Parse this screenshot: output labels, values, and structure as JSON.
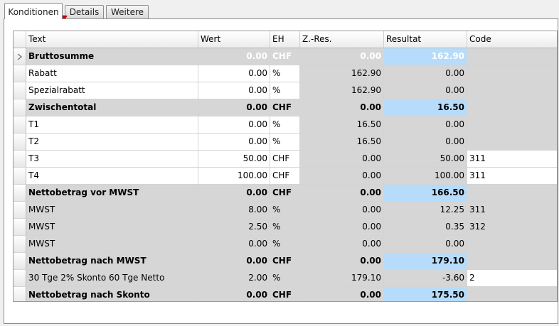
{
  "tabs": [
    {
      "label": "Konditionen",
      "active": true
    },
    {
      "label": "Details",
      "active": false
    },
    {
      "label": "Weitere",
      "active": false
    }
  ],
  "columns": {
    "text": "Text",
    "wert": "Wert",
    "eh": "EH",
    "zres": "Z.-Res.",
    "resultat": "Resultat",
    "code": "Code"
  },
  "rows": [
    {
      "text": "Bruttosumme",
      "wert": "0.00",
      "eh": "CHF",
      "zres": "0.00",
      "resultat": "162.90",
      "code": ""
    },
    {
      "text": "Rabatt",
      "wert": "0.00",
      "eh": "%",
      "zres": "162.90",
      "resultat": "0.00",
      "code": ""
    },
    {
      "text": "Spezialrabatt",
      "wert": "0.00",
      "eh": "%",
      "zres": "162.90",
      "resultat": "0.00",
      "code": ""
    },
    {
      "text": "Zwischentotal",
      "wert": "0.00",
      "eh": "CHF",
      "zres": "0.00",
      "resultat": "16.50",
      "code": ""
    },
    {
      "text": "T1",
      "wert": "0.00",
      "eh": "%",
      "zres": "16.50",
      "resultat": "0.00",
      "code": ""
    },
    {
      "text": "T2",
      "wert": "0.00",
      "eh": "%",
      "zres": "16.50",
      "resultat": "0.00",
      "code": ""
    },
    {
      "text": "T3",
      "wert": "50.00",
      "eh": "CHF",
      "zres": "0.00",
      "resultat": "50.00",
      "code": "311"
    },
    {
      "text": "T4",
      "wert": "100.00",
      "eh": "CHF",
      "zres": "0.00",
      "resultat": "100.00",
      "code": "311"
    },
    {
      "text": "Nettobetrag vor MWST",
      "wert": "0.00",
      "eh": "CHF",
      "zres": "0.00",
      "resultat": "166.50",
      "code": ""
    },
    {
      "text": "MWST",
      "wert": "8.00",
      "eh": "%",
      "zres": "0.00",
      "resultat": "12.25",
      "code": "311"
    },
    {
      "text": "MWST",
      "wert": "2.50",
      "eh": "%",
      "zres": "0.00",
      "resultat": "0.35",
      "code": "312"
    },
    {
      "text": "MWST",
      "wert": "0.00",
      "eh": "%",
      "zres": "0.00",
      "resultat": "0.00",
      "code": ""
    },
    {
      "text": "Nettobetrag nach MWST",
      "wert": "0.00",
      "eh": "CHF",
      "zres": "0.00",
      "resultat": "179.10",
      "code": ""
    },
    {
      "text": "30 Tge 2% Skonto 60 Tge Netto",
      "wert": "2.00",
      "eh": "%",
      "zres": "179.10",
      "resultat": "-3.60",
      "code": "2"
    },
    {
      "text": "Nettobetrag nach Skonto",
      "wert": "0.00",
      "eh": "CHF",
      "zres": "0.00",
      "resultat": "175.50",
      "code": ""
    }
  ],
  "colors": {
    "total_row": "#d6d6d6",
    "total_result": "#b7dcfb",
    "arrow": "#cc0000"
  }
}
